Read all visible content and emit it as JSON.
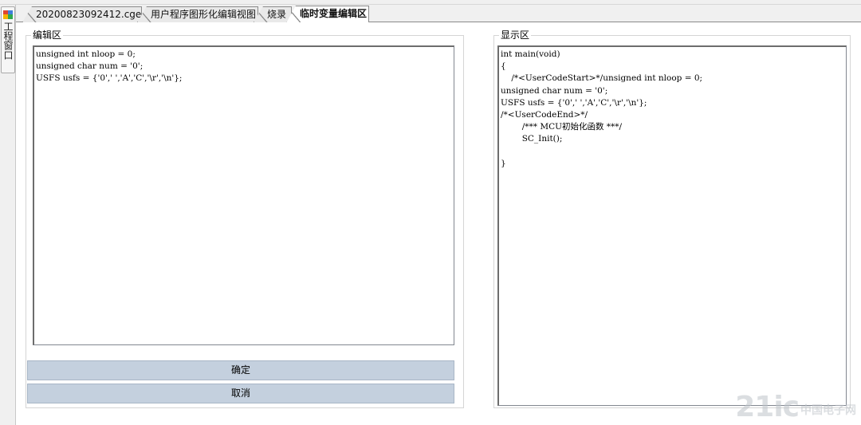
{
  "side_panel": {
    "label": "工程窗口",
    "icon": "project-window-icon"
  },
  "tabs": [
    {
      "label": "20200823092412.cgen",
      "active": false
    },
    {
      "label": "用户程序图形化编辑视图",
      "active": false
    },
    {
      "label": "烧录",
      "active": false
    },
    {
      "label": "临时变量编辑区",
      "active": true
    }
  ],
  "edit_area": {
    "title": "编辑区",
    "content": "unsigned int nloop = 0;\nunsigned char num = '0';\nUSFS usfs = {'0',' ','A','C','\\r','\\n'};"
  },
  "display_area": {
    "title": "显示区",
    "content": "int main(void)\n{\n    /*<UserCodeStart>*/unsigned int nloop = 0;\nunsigned char num = '0';\nUSFS usfs = {'0',' ','A','C','\\r','\\n'};\n/*<UserCodeEnd>*/\n        /*** MCU初始化函数 ***/\n        SC_Init();\n\n}"
  },
  "buttons": {
    "confirm": "确定",
    "cancel": "取消"
  },
  "watermark": {
    "logo": "21ic",
    "text": "中国电子网"
  }
}
